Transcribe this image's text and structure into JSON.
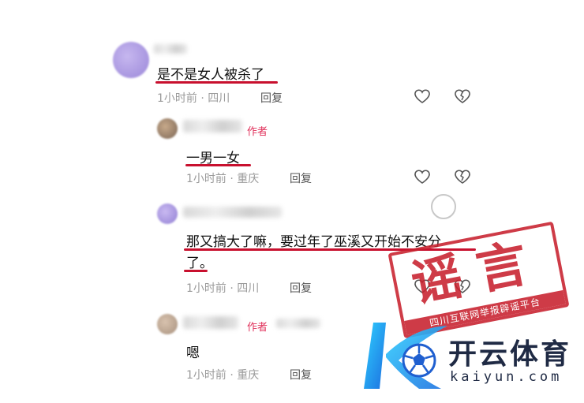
{
  "comments": [
    {
      "text": "是不是女人被杀了",
      "time": "1小时前",
      "location": "四川",
      "reply": "回复",
      "author_tag": ""
    },
    {
      "text": "一男一女",
      "time": "1小时前",
      "location": "重庆",
      "reply": "回复",
      "author_tag": "作者"
    },
    {
      "text_line1": "那又搞大了嘛，要过年了巫溪又开始不安分",
      "text_line2": "了。",
      "time": "1小时前",
      "location": "四川",
      "reply": "回复",
      "author_tag": ""
    },
    {
      "text": "嗯",
      "time": "1小时前",
      "location": "重庆",
      "reply": "回复",
      "author_tag": "作者"
    }
  ],
  "separator": "·",
  "stamp": {
    "main": "谣言",
    "sub": "四川互联网举报辟谣平台"
  },
  "watermark": {
    "name": "开云体育",
    "url": "kaiyun.com"
  },
  "colors": {
    "underline": "#c8102e",
    "author": "#e0305a",
    "stamp": "#c8212e",
    "watermark": "#1f2a44"
  },
  "icons": [
    "heart-icon",
    "heart-broken-icon"
  ]
}
